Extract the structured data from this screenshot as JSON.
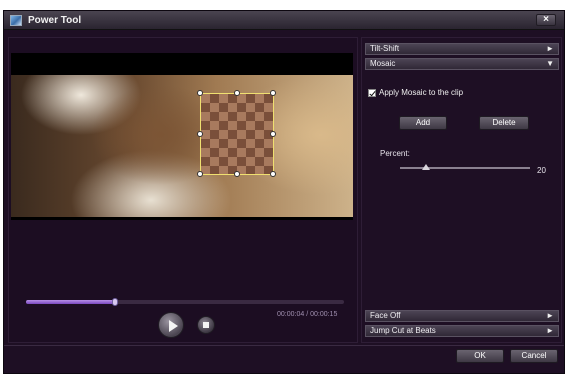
{
  "window": {
    "title": "Power Tool",
    "close_label": "×"
  },
  "player": {
    "time": "00:00:04 / 00:00:15",
    "progress": 0.28
  },
  "effects": {
    "tilt_shift": {
      "label": "Tilt-Shift",
      "arrow": "►"
    },
    "mosaic": {
      "label": "Mosaic",
      "arrow": "▼"
    },
    "apply_label": "Apply Mosaic to the clip",
    "apply_checked": true,
    "add_label": "Add",
    "delete_label": "Delete",
    "percent_label": "Percent:",
    "percent_value": "20",
    "face_off": {
      "label": "Face Off",
      "arrow": "►"
    },
    "jump_cut": {
      "label": "Jump Cut at Beats",
      "arrow": "►"
    }
  },
  "footer": {
    "ok_label": "OK",
    "cancel_label": "Cancel"
  },
  "colors": {
    "accent": "#8a5cd0",
    "background": "#1e0f24",
    "selection": "#f0e070"
  }
}
